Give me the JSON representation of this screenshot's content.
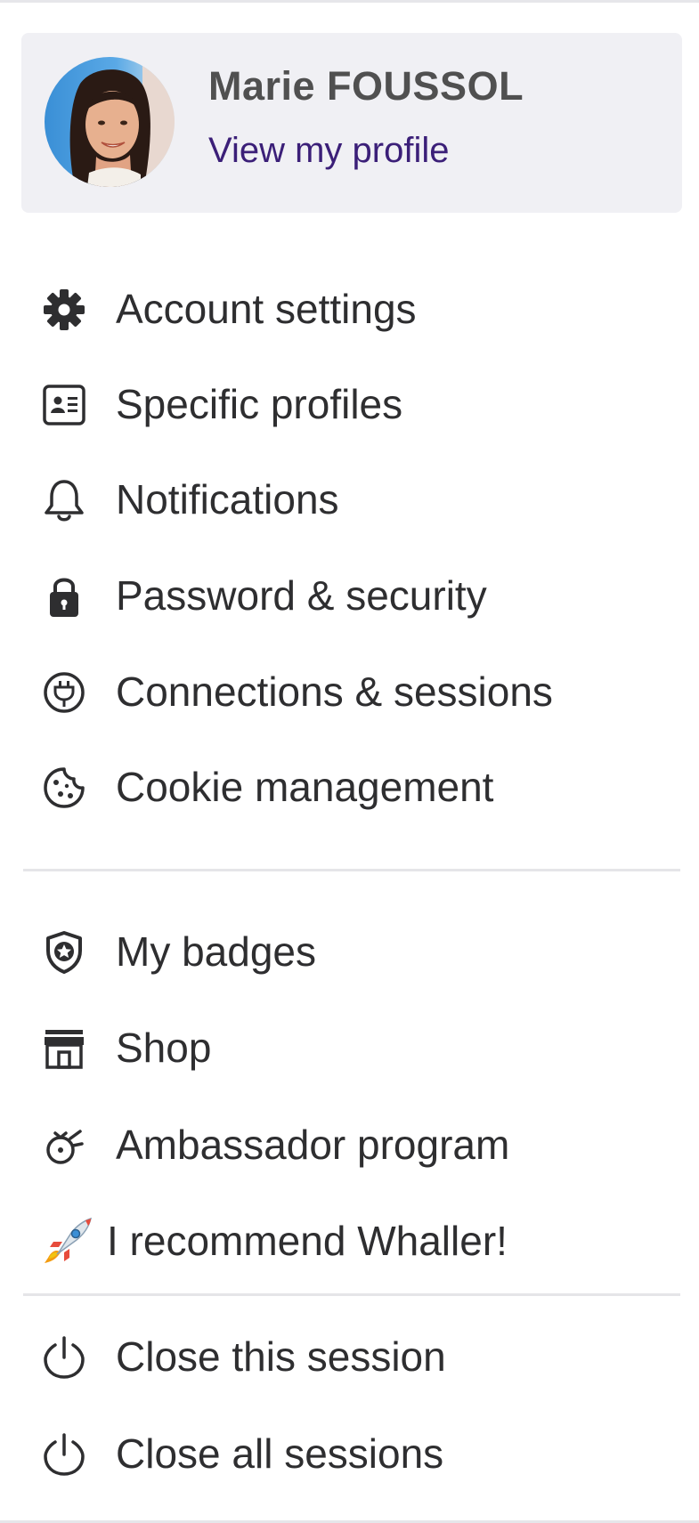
{
  "profile": {
    "name": "Marie FOUSSOL",
    "link_label": "View my profile"
  },
  "menu": {
    "account_settings": {
      "label": "Account settings",
      "icon": "gear-icon"
    },
    "specific_profiles": {
      "label": "Specific profiles",
      "icon": "id-card-icon"
    },
    "notifications": {
      "label": "Notifications",
      "icon": "bell-icon"
    },
    "password_security": {
      "label": "Password & security",
      "icon": "lock-icon"
    },
    "connections_sessions": {
      "label": "Connections & sessions",
      "icon": "plug-icon"
    },
    "cookie_management": {
      "label": "Cookie management",
      "icon": "cookie-icon"
    },
    "my_badges": {
      "label": "My badges",
      "icon": "badge-shield-icon"
    },
    "shop": {
      "label": "Shop",
      "icon": "store-icon"
    },
    "ambassador_program": {
      "label": "Ambassador program",
      "icon": "ambassador-icon"
    },
    "recommend": {
      "label": "I recommend Whaller!",
      "icon": "rocket-icon"
    },
    "close_session": {
      "label": "Close this session",
      "icon": "power-icon"
    },
    "close_all_sessions": {
      "label": "Close all sessions",
      "icon": "power-icon"
    }
  },
  "colors": {
    "card_background": "#f0f0f4",
    "profile_link": "#3b1f78",
    "name_text": "#505050",
    "item_text": "#2e2e30",
    "divider": "#e5e5e8"
  }
}
